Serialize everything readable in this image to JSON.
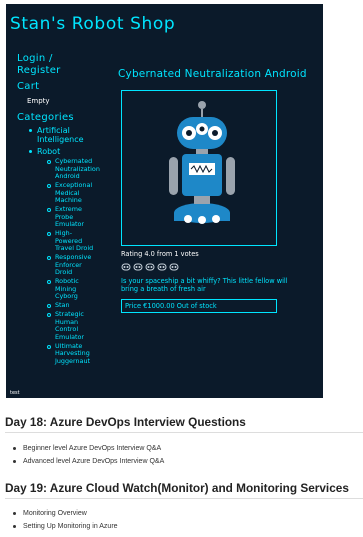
{
  "shop": {
    "title": "Stan's Robot Shop",
    "nav": {
      "login": "Login / Register",
      "cart": "Cart",
      "cart_status": "Empty",
      "categories_heading": "Categories",
      "categories": [
        {
          "label": "Artificial Intelligence"
        },
        {
          "label": "Robot"
        }
      ],
      "robot_items": [
        "Cybernated Neutralization Android",
        "Exceptional Medical Machine",
        "Extreme Probe Emulator",
        "High-Powered Travel Droid",
        "Responsive Enforcer Droid",
        "Robotic Mining Cyborg",
        "Stan",
        "Strategic Human Control Emulator",
        "Ultimate Harvesting Juggernaut"
      ]
    },
    "footer_tag": "test",
    "product": {
      "name": "Cybernated Neutralization Android",
      "rating_text": "Rating 4.0 from 1 votes",
      "vote_icon": "robot-head-icon",
      "vote_count_icons": 5,
      "description": "Is your spaceship a bit whiffy? This little fellow will bring a breath of fresh air",
      "price_text": "Price €1000.00 Out of stock"
    },
    "colors": {
      "background": "#0b1a2a",
      "accent": "#00e5ff",
      "robot_blue": "#1e88c8"
    }
  },
  "article": {
    "sections": [
      {
        "heading": "Day 18: Azure DevOps Interview Questions",
        "items": [
          "Beginner level Azure DevOps Interview Q&A",
          "Advanced level Azure DevOps Interview Q&A"
        ]
      },
      {
        "heading": "Day 19: Azure Cloud Watch(Monitor) and Monitoring Services",
        "items": [
          "Monitoring Overview",
          "Setting Up Monitoring in Azure"
        ]
      }
    ]
  }
}
